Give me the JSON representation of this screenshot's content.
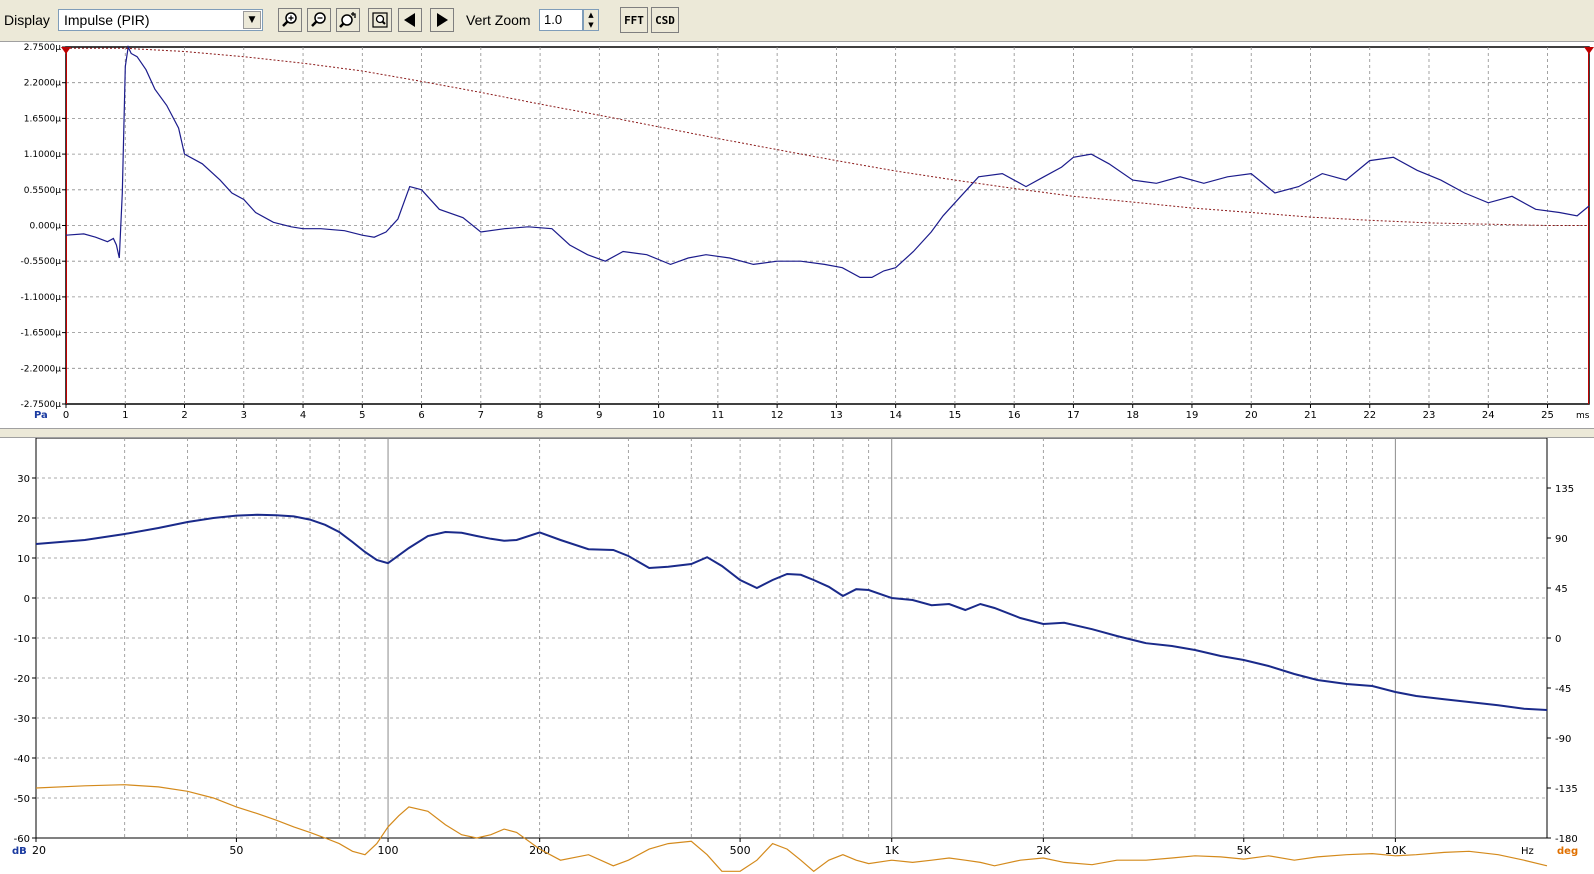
{
  "toolbar": {
    "display_label": "Display",
    "display_value": "Impulse (PIR)",
    "vert_zoom_label": "Vert Zoom",
    "vert_zoom_value": "1.0",
    "fft_label": "FFT",
    "csd_label": "CSD"
  },
  "chart_data": [
    {
      "type": "line",
      "y_unit": "Pa",
      "x_unit": "ms",
      "xlim": [
        0,
        25.7
      ],
      "ylim": [
        -2.75,
        2.75
      ],
      "x_ticks": [
        "0",
        "1",
        "2",
        "3",
        "4",
        "5",
        "6",
        "7",
        "8",
        "9",
        "10",
        "11",
        "12",
        "13",
        "14",
        "15",
        "16",
        "17",
        "18",
        "19",
        "20",
        "21",
        "22",
        "23",
        "24",
        "25"
      ],
      "y_ticks": [
        "2.7500µ",
        "2.2000µ",
        "1.6500µ",
        "1.1000µ",
        "0.5500µ",
        "0.000µ",
        "-0.5500µ",
        "-1.1000µ",
        "-1.6500µ",
        "-2.2000µ",
        "-2.7500µ"
      ],
      "y_tick_values": [
        2.75,
        2.2,
        1.65,
        1.1,
        0.55,
        0,
        -0.55,
        -1.1,
        -1.65,
        -2.2,
        -2.75
      ],
      "grid": true,
      "series": [
        {
          "color": "#1c1c8c",
          "x": [
            0,
            0.3,
            0.5,
            0.7,
            0.8,
            0.85,
            0.9,
            0.95,
            1.0,
            1.05,
            1.1,
            1.2,
            1.35,
            1.5,
            1.7,
            1.9,
            2.0,
            2.3,
            2.6,
            2.8,
            3.0,
            3.2,
            3.5,
            3.8,
            4.0,
            4.3,
            4.7,
            5.0,
            5.2,
            5.4,
            5.6,
            5.8,
            6.0,
            6.3,
            6.7,
            7.0,
            7.4,
            7.8,
            8.2,
            8.5,
            8.8,
            9.1,
            9.4,
            9.8,
            10.2,
            10.5,
            10.8,
            11.2,
            11.6,
            12.0,
            12.4,
            12.8,
            13.1,
            13.4,
            13.6,
            13.8,
            14.0,
            14.3,
            14.6,
            14.8,
            15.0,
            15.4,
            15.8,
            16.2,
            16.5,
            16.8,
            17.0,
            17.3,
            17.6,
            18.0,
            18.4,
            18.8,
            19.2,
            19.6,
            20.0,
            20.4,
            20.8,
            21.2,
            21.6,
            22.0,
            22.4,
            22.8,
            23.2,
            23.6,
            24.0,
            24.4,
            24.8,
            25.2,
            25.5,
            25.7
          ],
          "y": [
            -0.15,
            -0.13,
            -0.18,
            -0.25,
            -0.2,
            -0.3,
            -0.5,
            0.5,
            2.45,
            2.75,
            2.65,
            2.6,
            2.4,
            2.1,
            1.85,
            1.5,
            1.1,
            0.95,
            0.7,
            0.5,
            0.4,
            0.2,
            0.05,
            -0.02,
            -0.05,
            -0.05,
            -0.08,
            -0.15,
            -0.18,
            -0.1,
            0.1,
            0.6,
            0.55,
            0.25,
            0.12,
            -0.1,
            -0.05,
            -0.02,
            -0.05,
            -0.3,
            -0.45,
            -0.55,
            -0.4,
            -0.45,
            -0.6,
            -0.5,
            -0.45,
            -0.5,
            -0.6,
            -0.55,
            -0.55,
            -0.6,
            -0.65,
            -0.8,
            -0.8,
            -0.7,
            -0.65,
            -0.4,
            -0.1,
            0.15,
            0.35,
            0.75,
            0.8,
            0.6,
            0.75,
            0.9,
            1.05,
            1.1,
            0.95,
            0.7,
            0.65,
            0.75,
            0.65,
            0.75,
            0.8,
            0.5,
            0.6,
            0.8,
            0.7,
            1.0,
            1.05,
            0.85,
            0.7,
            0.5,
            0.35,
            0.45,
            0.25,
            0.2,
            0.15,
            0.3
          ]
        },
        {
          "color": "#8b1a1a",
          "dashed": true,
          "x": [
            0,
            1,
            2,
            3,
            4,
            5,
            6,
            7,
            8,
            9,
            10,
            11,
            12,
            13,
            14,
            15,
            16,
            17,
            18,
            19,
            20,
            21,
            22,
            23,
            24,
            25,
            25.7
          ],
          "y": [
            2.73,
            2.73,
            2.68,
            2.6,
            2.5,
            2.38,
            2.22,
            2.05,
            1.87,
            1.7,
            1.52,
            1.34,
            1.17,
            1.0,
            0.84,
            0.7,
            0.57,
            0.45,
            0.36,
            0.27,
            0.2,
            0.13,
            0.08,
            0.04,
            0.02,
            0.0,
            0.0
          ]
        }
      ]
    },
    {
      "type": "line",
      "x_scale": "log",
      "x_unit": "Hz",
      "y_unit": "dB",
      "y2_unit": "deg",
      "xlim": [
        20,
        20000
      ],
      "ylim": [
        -60,
        40
      ],
      "y2lim": [
        -180,
        180
      ],
      "x_ticks": [
        {
          "value": 20,
          "label": "20"
        },
        {
          "value": 50,
          "label": "50"
        },
        {
          "value": 100,
          "label": "100"
        },
        {
          "value": 200,
          "label": "200"
        },
        {
          "value": 500,
          "label": "500"
        },
        {
          "value": 1000,
          "label": "1K"
        },
        {
          "value": 2000,
          "label": "2K"
        },
        {
          "value": 5000,
          "label": "5K"
        },
        {
          "value": 10000,
          "label": "10K"
        }
      ],
      "y_ticks": [
        30,
        20,
        10,
        0,
        -10,
        -20,
        -30,
        -40,
        -50,
        -60
      ],
      "y2_ticks": [
        135,
        90,
        45,
        0,
        -45,
        -90,
        -135,
        -180
      ],
      "grid": true,
      "series": [
        {
          "color": "#1a2a8a",
          "axis": "left",
          "x": [
            20,
            25,
            30,
            35,
            40,
            45,
            50,
            55,
            60,
            65,
            70,
            75,
            80,
            85,
            90,
            95,
            100,
            110,
            120,
            130,
            140,
            150,
            160,
            170,
            180,
            200,
            220,
            250,
            280,
            300,
            330,
            360,
            400,
            430,
            460,
            500,
            540,
            580,
            620,
            660,
            700,
            750,
            800,
            850,
            900,
            1000,
            1100,
            1200,
            1300,
            1400,
            1500,
            1600,
            1800,
            2000,
            2200,
            2500,
            2800,
            3200,
            3600,
            4000,
            4500,
            5000,
            5600,
            6300,
            7000,
            8000,
            9000,
            10000,
            11000,
            12500,
            14000,
            16000,
            18000,
            20000
          ],
          "y": [
            13.5,
            14.5,
            16,
            17.5,
            19,
            20,
            20.6,
            20.8,
            20.7,
            20.4,
            19.6,
            18.3,
            16.5,
            14,
            11.5,
            9.5,
            8.7,
            12.5,
            15.5,
            16.5,
            16.3,
            15.5,
            14.8,
            14.3,
            14.5,
            16.4,
            14.5,
            12.2,
            12,
            10.5,
            7.5,
            7.8,
            8.5,
            10.2,
            8,
            4.5,
            2.5,
            4.5,
            6,
            5.8,
            4.5,
            2.8,
            0.5,
            2.2,
            2,
            0,
            -0.5,
            -1.8,
            -1.5,
            -3,
            -1.5,
            -2.5,
            -5,
            -6.5,
            -6.2,
            -7.8,
            -9.5,
            -11.3,
            -12,
            -13,
            -14.5,
            -15.5,
            -17,
            -19,
            -20.5,
            -21.5,
            -22,
            -23.5,
            -24.5,
            -25.3,
            -26,
            -26.8,
            -27.7,
            -28
          ]
        },
        {
          "color": "#d48a1c",
          "axis": "right",
          "x": [
            20,
            25,
            30,
            35,
            40,
            45,
            50,
            55,
            60,
            65,
            70,
            75,
            80,
            85,
            90,
            95,
            100,
            105,
            110,
            120,
            130,
            140,
            150,
            160,
            170,
            180,
            200,
            220,
            250,
            280,
            300,
            330,
            360,
            400,
            430,
            460,
            500,
            540,
            580,
            620,
            660,
            700,
            750,
            800,
            850,
            900,
            1000,
            1100,
            1200,
            1300,
            1400,
            1500,
            1600,
            1800,
            2000,
            2200,
            2500,
            2800,
            3200,
            3600,
            4000,
            4500,
            5000,
            5600,
            6300,
            7000,
            8000,
            9000,
            10000,
            11000,
            12500,
            14000,
            16000,
            18000,
            20000
          ],
          "y": [
            -135,
            -133,
            -132,
            -134,
            -138,
            -144,
            -152,
            -158,
            -164,
            -170,
            -175,
            -180,
            -185,
            -192,
            -195,
            -185,
            -170,
            -160,
            -152,
            -156,
            -168,
            -177,
            -180,
            -177,
            -172,
            -175,
            -190,
            -200,
            -195,
            -205,
            -200,
            -190,
            -185,
            -183,
            -195,
            -210,
            -210,
            -200,
            -185,
            -190,
            -200,
            -210,
            -200,
            -195,
            -200,
            -203,
            -200,
            -202,
            -200,
            -198,
            -200,
            -202,
            -205,
            -200,
            -198,
            -202,
            -204,
            -200,
            -200,
            -198,
            -196,
            -197,
            -199,
            -196,
            -200,
            -197,
            -195,
            -194,
            -196,
            -195,
            -193,
            -192,
            -195,
            -200,
            -205
          ]
        }
      ]
    }
  ]
}
